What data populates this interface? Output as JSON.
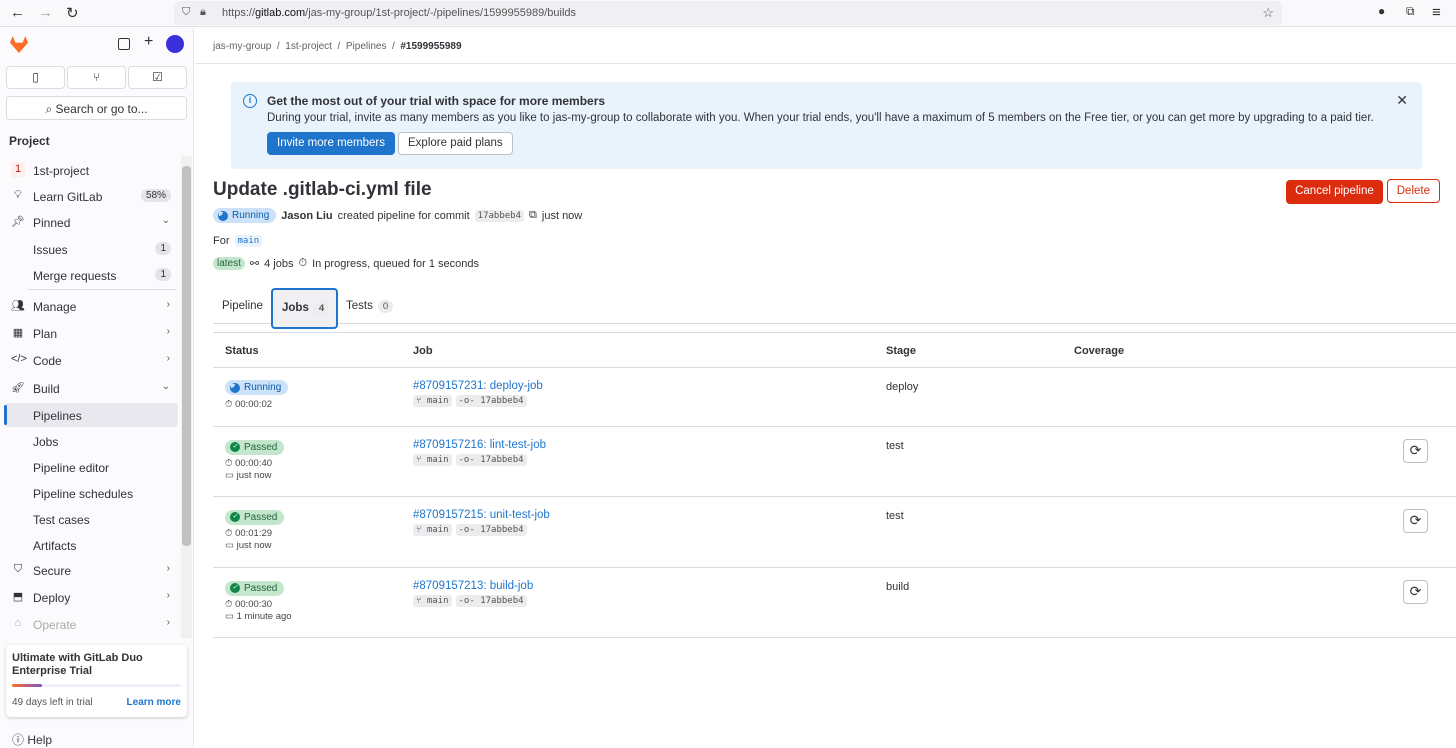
{
  "browser": {
    "url_prefix": "https://",
    "url_domain": "gitlab.com",
    "url_path": "/jas-my-group/1st-project/-/pipelines/1599955989/builds"
  },
  "sidebar": {
    "search": "Search or go to...",
    "section": "Project",
    "project_initial": "1",
    "items": [
      {
        "label": "1st-project"
      },
      {
        "label": "Learn GitLab",
        "count": "58%"
      },
      {
        "label": "Pinned"
      },
      {
        "label": "Issues",
        "count": "1"
      },
      {
        "label": "Merge requests",
        "count": "1"
      },
      {
        "label": "Manage"
      },
      {
        "label": "Plan"
      },
      {
        "label": "Code"
      },
      {
        "label": "Build"
      },
      {
        "label": "Pipelines"
      },
      {
        "label": "Jobs"
      },
      {
        "label": "Pipeline editor"
      },
      {
        "label": "Pipeline schedules"
      },
      {
        "label": "Test cases"
      },
      {
        "label": "Artifacts"
      },
      {
        "label": "Secure"
      },
      {
        "label": "Deploy"
      },
      {
        "label": "Operate"
      }
    ],
    "trial": {
      "title": "Ultimate with GitLab Duo Enterprise Trial",
      "progress": 0.18,
      "days_left": "49 days left in trial",
      "learn_more": "Learn more"
    },
    "help": "Help"
  },
  "breadcrumb": [
    "jas-my-group",
    "1st-project",
    "Pipelines",
    "#1599955989"
  ],
  "alert": {
    "title": "Get the most out of your trial with space for more members",
    "body": "During your trial, invite as many members as you like to jas-my-group to collaborate with you. When your trial ends, you'll have a maximum of 5 members on the Free tier, or you can get more by upgrading to a paid tier.",
    "invite": "Invite more members",
    "explore": "Explore paid plans"
  },
  "pipeline": {
    "title": "Update .gitlab-ci.yml file",
    "status": "Running",
    "author": "Jason Liu",
    "created_text": "created pipeline for commit",
    "commit": "17abbeb4",
    "time": "just now",
    "for_label": "For",
    "branch": "main",
    "latest": "latest",
    "jobs_count": "4 jobs",
    "progress_text": "In progress, queued for 1 seconds",
    "cancel": "Cancel pipeline",
    "delete": "Delete"
  },
  "tabs": [
    {
      "label": "Pipeline"
    },
    {
      "label": "Jobs",
      "count": "4"
    },
    {
      "label": "Tests",
      "count": "0"
    }
  ],
  "table": {
    "headers": [
      "Status",
      "Job",
      "Stage",
      "Coverage"
    ],
    "rows": [
      {
        "status": "Running",
        "duration": "00:00:02",
        "job": "#8709157231: deploy-job",
        "branch": "main",
        "commit": "17abbeb4",
        "stage": "deploy"
      },
      {
        "status": "Passed",
        "duration": "00:00:40",
        "finished": "just now",
        "job": "#8709157216: lint-test-job",
        "branch": "main",
        "commit": "17abbeb4",
        "stage": "test"
      },
      {
        "status": "Passed",
        "duration": "00:01:29",
        "finished": "just now",
        "job": "#8709157215: unit-test-job",
        "branch": "main",
        "commit": "17abbeb4",
        "stage": "test"
      },
      {
        "status": "Passed",
        "duration": "00:00:30",
        "finished": "1 minute ago",
        "job": "#8709157213: build-job",
        "branch": "main",
        "commit": "17abbeb4",
        "stage": "build"
      }
    ]
  }
}
